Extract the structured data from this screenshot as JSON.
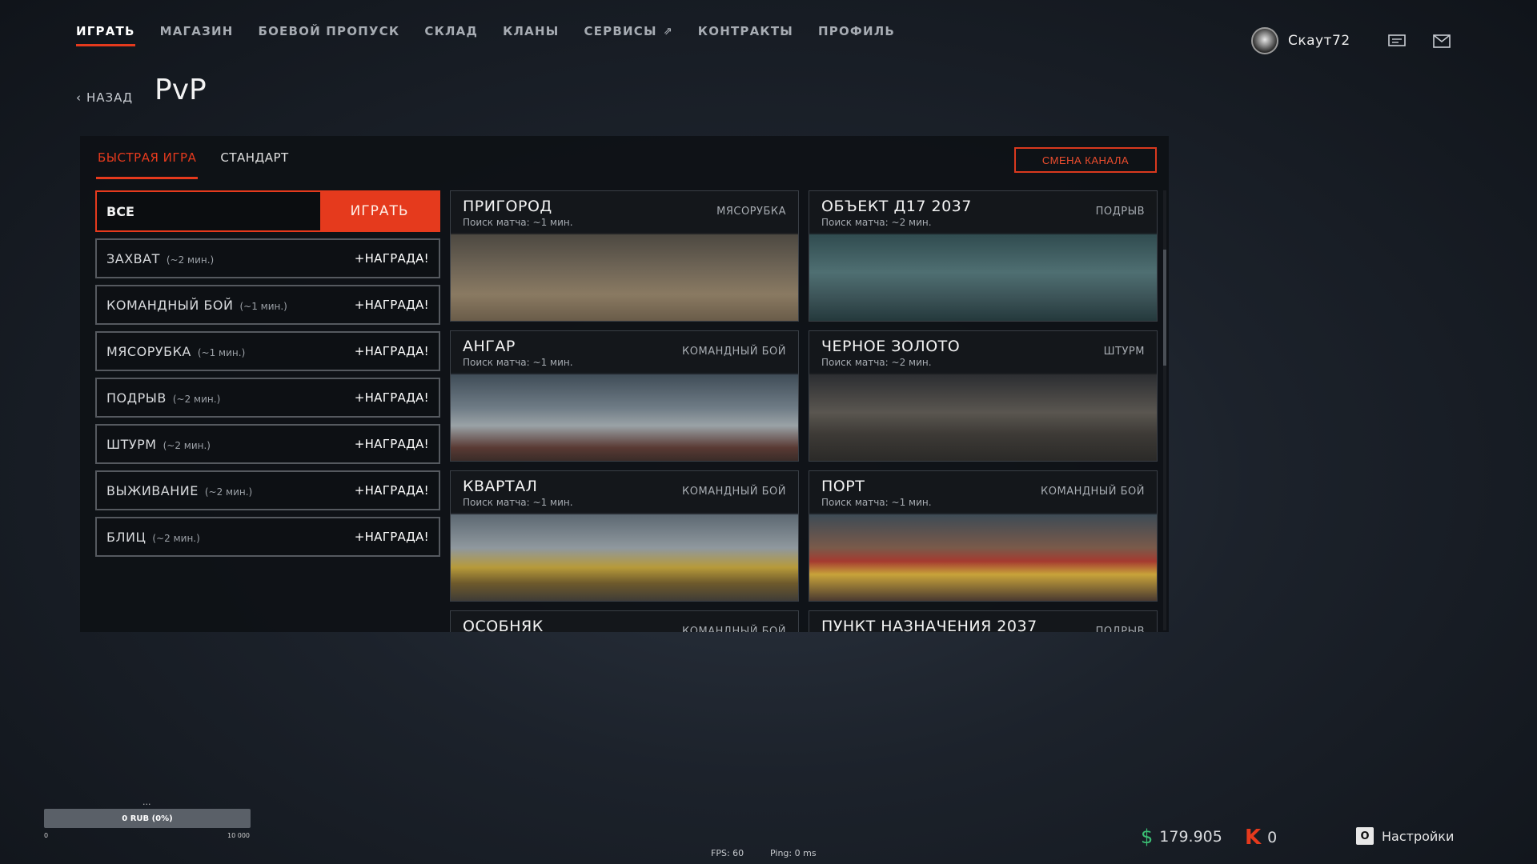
{
  "nav": [
    {
      "label": "ИГРАТЬ",
      "active": true
    },
    {
      "label": "МАГАЗИН"
    },
    {
      "label": "БОЕВОЙ ПРОПУСК"
    },
    {
      "label": "СКЛАД"
    },
    {
      "label": "КЛАНЫ"
    },
    {
      "label": "СЕРВИСЫ",
      "external": true
    },
    {
      "label": "КОНТРАКТЫ"
    },
    {
      "label": "ПРОФИЛЬ"
    }
  ],
  "user": {
    "name": "Скаут72"
  },
  "back_label": "НАЗАД",
  "page_title": "PvP",
  "tabs": [
    {
      "label": "БЫСТРАЯ ИГРА",
      "active": true
    },
    {
      "label": "СТАНДАРТ"
    }
  ],
  "channel_button": "СМЕНА КАНАЛА",
  "mode_all": {
    "label": "ВСЕ",
    "play_label": "ИГРАТЬ"
  },
  "modes": [
    {
      "name": "ЗАХВАТ",
      "time": "(~2 мин.)",
      "reward": "+НАГРАДА!"
    },
    {
      "name": "КОМАНДНЫЙ БОЙ",
      "time": "(~1 мин.)",
      "reward": "+НАГРАДА!"
    },
    {
      "name": "МЯСОРУБКА",
      "time": "(~1 мин.)",
      "reward": "+НАГРАДА!"
    },
    {
      "name": "ПОДРЫВ",
      "time": "(~2 мин.)",
      "reward": "+НАГРАДА!"
    },
    {
      "name": "ШТУРМ",
      "time": "(~2 мин.)",
      "reward": "+НАГРАДА!"
    },
    {
      "name": "ВЫЖИВАНИЕ",
      "time": "(~2 мин.)",
      "reward": "+НАГРАДА!"
    },
    {
      "name": "БЛИЦ",
      "time": "(~2 мин.)",
      "reward": "+НАГРАДА!"
    }
  ],
  "maps": [
    {
      "name": "ПРИГОРОД",
      "wait": "Поиск матча: ~1 мин.",
      "mode": "МЯСОРУБКА"
    },
    {
      "name": "ОБЪЕКТ Д17 2037",
      "wait": "Поиск матча: ~2 мин.",
      "mode": "ПОДРЫВ"
    },
    {
      "name": "АНГАР",
      "wait": "Поиск матча: ~1 мин.",
      "mode": "КОМАНДНЫЙ БОЙ"
    },
    {
      "name": "ЧЕРНОЕ ЗОЛОТО",
      "wait": "Поиск матча: ~2 мин.",
      "mode": "ШТУРМ"
    },
    {
      "name": "КВАРТАЛ",
      "wait": "Поиск матча: ~1 мин.",
      "mode": "КОМАНДНЫЙ БОЙ"
    },
    {
      "name": "ПОРТ",
      "wait": "Поиск матча: ~1 мин.",
      "mode": "КОМАНДНЫЙ БОЙ"
    },
    {
      "name": "ОСОБНЯК",
      "wait": "",
      "mode": "КОМАНДНЫЙ БОЙ"
    },
    {
      "name": "ПУНКТ НАЗНАЧЕНИЯ 2037",
      "wait": "",
      "mode": "ПОДРЫВ"
    }
  ],
  "progress": {
    "dots": "...",
    "label": "0 RUB (0%)",
    "value": 0,
    "min": "0",
    "max": "10 000"
  },
  "stats": {
    "fps": "FPS: 60",
    "ping": "Ping: 0 ms"
  },
  "currency": {
    "dollars": "179.905",
    "k": "0"
  },
  "settings": {
    "key": "O",
    "label": "Настройки"
  },
  "colors": {
    "accent": "#e53a1d",
    "dollar": "#3bbf74"
  }
}
